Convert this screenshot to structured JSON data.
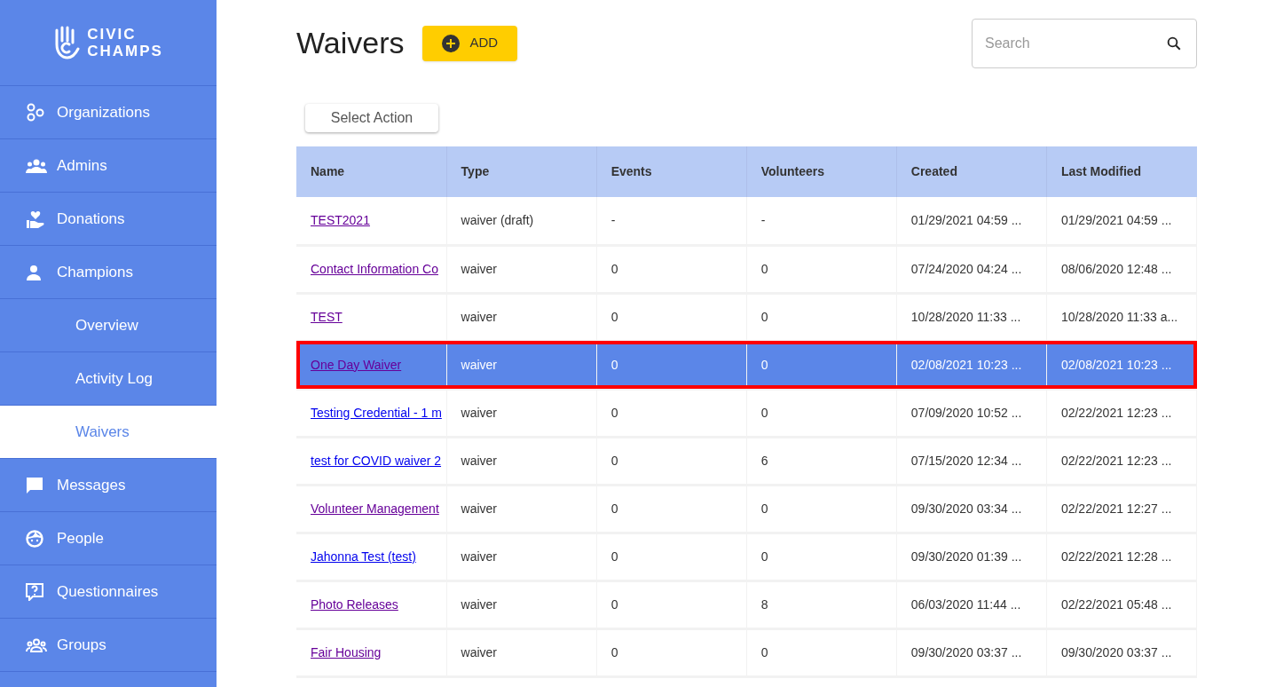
{
  "sidebar": {
    "logo": [
      "CIVIC",
      "CHAMPS"
    ],
    "items": [
      {
        "label": "Organizations",
        "kind": "main",
        "selected": false
      },
      {
        "label": "Admins",
        "kind": "main",
        "selected": false
      },
      {
        "label": "Donations",
        "kind": "main",
        "selected": false
      },
      {
        "label": "Champions",
        "kind": "main",
        "selected": false
      },
      {
        "label": "Overview",
        "kind": "sub",
        "selected": false
      },
      {
        "label": "Activity Log",
        "kind": "sub",
        "selected": false
      },
      {
        "label": "Waivers",
        "kind": "sub",
        "selected": true
      },
      {
        "label": "Messages",
        "kind": "main",
        "selected": false
      },
      {
        "label": "People",
        "kind": "main",
        "selected": false
      },
      {
        "label": "Questionnaires",
        "kind": "main",
        "selected": false
      },
      {
        "label": "Groups",
        "kind": "main",
        "selected": false
      }
    ]
  },
  "header": {
    "title": "Waivers",
    "add_button": "ADD",
    "search": {
      "placeholder": "Search"
    }
  },
  "select_action": "Select Action",
  "table": {
    "columns": [
      "Name",
      "Type",
      "Events",
      "Volunteers",
      "Created",
      "Last Modified"
    ],
    "rows": [
      {
        "cells": [
          "TEST2021",
          "waiver (draft)",
          "-",
          "-",
          "01/29/2021 04:59 ...",
          "01/29/2021 04:59 ..."
        ],
        "visited": true,
        "selected": false
      },
      {
        "cells": [
          "Contact Information Co",
          "waiver",
          "0",
          "0",
          "07/24/2020 04:24 ...",
          "08/06/2020 12:48 ..."
        ],
        "visited": true,
        "selected": false
      },
      {
        "cells": [
          "TEST",
          "waiver",
          "0",
          "0",
          "10/28/2020 11:33 ...",
          "10/28/2020 11:33 a..."
        ],
        "visited": true,
        "selected": false
      },
      {
        "cells": [
          "One Day Waiver",
          "waiver",
          "0",
          "0",
          "02/08/2021 10:23 ...",
          "02/08/2021 10:23 ..."
        ],
        "visited": true,
        "selected": true
      },
      {
        "cells": [
          "Testing Credential - 1 m",
          "waiver",
          "0",
          "0",
          "07/09/2020 10:52 ...",
          "02/22/2021 12:23 ..."
        ],
        "visited": false,
        "selected": false
      },
      {
        "cells": [
          "test for COVID waiver 2",
          "waiver",
          "0",
          "6",
          "07/15/2020 12:34 ...",
          "02/22/2021 12:23 ..."
        ],
        "visited": false,
        "selected": false
      },
      {
        "cells": [
          "Volunteer Management",
          "waiver",
          "0",
          "0",
          "09/30/2020 03:34 ...",
          "02/22/2021 12:27 ..."
        ],
        "visited": true,
        "selected": false
      },
      {
        "cells": [
          "Jahonna Test (test)",
          "waiver",
          "0",
          "0",
          "09/30/2020 01:39 ...",
          "02/22/2021 12:28 ..."
        ],
        "visited": false,
        "selected": false
      },
      {
        "cells": [
          "Photo Releases",
          "waiver",
          "0",
          "8",
          "06/03/2020 11:44 ...",
          "02/22/2021 05:48 ..."
        ],
        "visited": true,
        "selected": false
      },
      {
        "cells": [
          "Fair Housing",
          "waiver",
          "0",
          "0",
          "09/30/2020 03:37 ...",
          "09/30/2020 03:37 ..."
        ],
        "visited": true,
        "selected": false
      }
    ]
  }
}
